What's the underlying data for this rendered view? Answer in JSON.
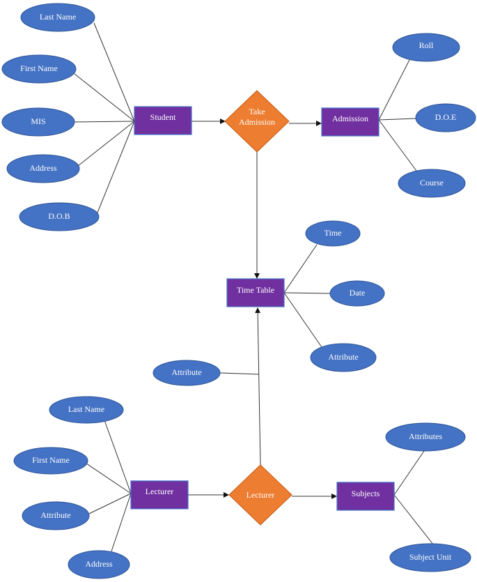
{
  "entities": {
    "student": "Student",
    "admission": "Admission",
    "time_table": "Time Table",
    "lecturer": "Lecturer",
    "subjects": "Subjects"
  },
  "relationships": {
    "take_admission": [
      "Take",
      "Admission"
    ],
    "lecturer": "Lecturer"
  },
  "student_attributes": [
    "Last Name",
    "First Name",
    "MIS",
    "Address",
    "D.O.B"
  ],
  "admission_attributes": [
    "Roll",
    "D.O.E",
    "Course"
  ],
  "time_table_attributes": [
    "Time",
    "Date",
    "Attribute"
  ],
  "relationship_attribute": "Attribute",
  "lecturer_attributes": [
    "Last Name",
    "First Name",
    "Attribute",
    "Address"
  ],
  "subjects_attributes": [
    "Attributes",
    "Subject Unit"
  ],
  "colors": {
    "entity": "#7030a0",
    "relationship": "#ed7d31",
    "attribute": "#4472c4"
  }
}
